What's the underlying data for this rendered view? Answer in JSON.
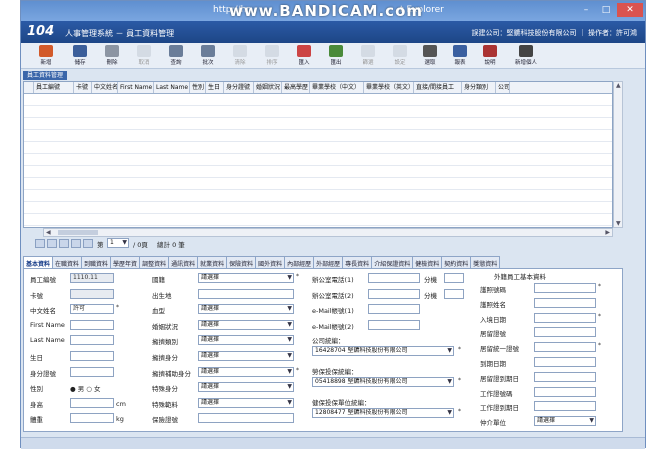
{
  "window": {
    "title_url": "http://hr",
    "title_app": "t Explorer",
    "watermark": "www.BANDICAM.com"
  },
  "app": {
    "logo": "104",
    "title": "人事管理系統 － 員工資料管理",
    "company": "誤建公司：堅鑣科技股份有限公司 ｜ 操作者：許可鴻"
  },
  "toolbar": [
    {
      "label": "新增",
      "icon": "new-icon",
      "color": "#d25a2a",
      "enabled": true
    },
    {
      "label": "儲存",
      "icon": "save-icon",
      "color": "#3b5e9a",
      "enabled": true
    },
    {
      "label": "刪除",
      "icon": "delete-icon",
      "color": "#8c95a3",
      "enabled": true
    },
    {
      "label": "取消",
      "icon": "cancel-icon",
      "color": "#b0b8c4",
      "enabled": false
    },
    {
      "label": "查詢",
      "icon": "query-icon",
      "color": "#6a7d99",
      "enabled": true
    },
    {
      "label": "批次",
      "icon": "batch-icon",
      "color": "#6a7d99",
      "enabled": true
    },
    {
      "label": "清除",
      "icon": "clear-icon",
      "color": "#b0b8c4",
      "enabled": false
    },
    {
      "label": "排序",
      "icon": "sort-icon",
      "color": "#b0b8c4",
      "enabled": false
    },
    {
      "label": "匯入",
      "icon": "import-icon",
      "color": "#c44",
      "enabled": true
    },
    {
      "label": "匯出",
      "icon": "export-icon",
      "color": "#4a8a3a",
      "enabled": true
    },
    {
      "label": "篩選",
      "icon": "filter-icon",
      "color": "#b0b8c4",
      "enabled": false
    },
    {
      "label": "設定",
      "icon": "settings-icon",
      "color": "#b0b8c4",
      "enabled": false
    },
    {
      "label": "選取",
      "icon": "select-icon",
      "color": "#555",
      "enabled": true
    },
    {
      "label": "報表",
      "icon": "report-icon",
      "color": "#3a5fa0",
      "enabled": true
    },
    {
      "label": "說明",
      "icon": "help-icon",
      "color": "#aa3333",
      "enabled": true
    },
    {
      "label": "新增個人",
      "icon": "add-person-icon",
      "color": "#444",
      "enabled": true
    }
  ],
  "grid": {
    "group_title": "員工資料管理",
    "columns": [
      "員工編號",
      "卡號",
      "中文姓名",
      "First Name",
      "Last Name",
      "性別",
      "生日",
      "身分證號",
      "婚姻狀況",
      "最高學歷",
      "畢業學校（中文）",
      "畢業學校（英文）",
      "直接/間接員工",
      "身分類別",
      "公司"
    ]
  },
  "pager": {
    "page_label": "第",
    "page_value": "1",
    "total_label": "/ 0頁",
    "count_label": "總計 0 筆"
  },
  "tabs": [
    "基本資料",
    "在職資料",
    "到職資料",
    "學歷年資",
    "調整資料",
    "通訊資料",
    "就業資料",
    "保險資料",
    "國外資料",
    "內部經歷",
    "外部經歷",
    "專長資料",
    "介紹保證資料",
    "健檢資料",
    "契約資料",
    "獎懲資料"
  ],
  "form": {
    "col1": [
      {
        "label": "員工編號",
        "value": "1110.11",
        "type": "ro"
      },
      {
        "label": "卡號",
        "value": "",
        "type": "ro"
      },
      {
        "label": "中文姓名",
        "value": "許可",
        "type": "text",
        "star": "*"
      },
      {
        "label": "First Name",
        "value": "",
        "type": "text"
      },
      {
        "label": "Last Name",
        "value": "",
        "type": "text"
      },
      {
        "label": "生日",
        "value": "",
        "type": "text"
      },
      {
        "label": "身分證號",
        "value": "",
        "type": "text"
      },
      {
        "label": "性別",
        "value": "",
        "type": "radio"
      },
      {
        "label": "身高",
        "value": "",
        "type": "text",
        "unit": "cm"
      },
      {
        "label": "體重",
        "value": "",
        "type": "text",
        "unit": "kg"
      }
    ],
    "gender": {
      "male": "男",
      "female": "女"
    },
    "col2": [
      {
        "label": "國籍",
        "value": "請選擇",
        "type": "select",
        "star": "*"
      },
      {
        "label": "出生地",
        "value": "",
        "type": "text"
      },
      {
        "label": "血型",
        "value": "請選擇",
        "type": "select"
      },
      {
        "label": "婚姻狀況",
        "value": "請選擇",
        "type": "select"
      },
      {
        "label": "擁擠類別",
        "value": "請選擇",
        "type": "select"
      },
      {
        "label": "擁擠身分",
        "value": "請選擇",
        "type": "select"
      },
      {
        "label": "擁擠補助身分",
        "value": "請選擇",
        "type": "select",
        "star": "*"
      },
      {
        "label": "特殊身分",
        "value": "請選擇",
        "type": "select"
      },
      {
        "label": "特殊範料",
        "value": "請選擇",
        "type": "select"
      },
      {
        "label": "保險證號",
        "value": "",
        "type": "text"
      }
    ],
    "col3": [
      {
        "label": "辦公室電話(1)",
        "value": "",
        "type": "text",
        "ext": "分機"
      },
      {
        "label": "辦公室電話(2)",
        "value": "",
        "type": "text",
        "ext": "分機"
      },
      {
        "label": "e-Mail帳號(1)",
        "value": "",
        "type": "text"
      },
      {
        "label": "e-Mail帳號(2)",
        "value": "",
        "type": "text"
      }
    ],
    "company_label": "公司統編：",
    "company_value": "16428704 堅鑣科技股份有限公司",
    "dept_label": "勞保投保統編：",
    "dept_value": "05418898 堅鑣科技股份有限公司",
    "health_label": "健保投保單位統編：",
    "health_value": "12808477 堅鑣科技股份有限公司",
    "foreign_title": "外籍員工基本資料",
    "col4": [
      {
        "label": "護照號碼",
        "value": "",
        "type": "text",
        "star": "*"
      },
      {
        "label": "護照姓名",
        "value": "",
        "type": "text"
      },
      {
        "label": "入境日期",
        "value": "",
        "type": "text",
        "star": "*"
      },
      {
        "label": "居留證號",
        "value": "",
        "type": "text"
      },
      {
        "label": "居留統一證號",
        "value": "",
        "type": "text",
        "star": "*"
      },
      {
        "label": "到期日期",
        "value": "",
        "type": "text"
      },
      {
        "label": "居留證到期日",
        "value": "",
        "type": "text"
      },
      {
        "label": "工作證號碼",
        "value": "",
        "type": "text"
      },
      {
        "label": "工作證到期日",
        "value": "",
        "type": "text"
      },
      {
        "label": "仲介單位",
        "value": "請選擇",
        "type": "select"
      }
    ]
  },
  "select_default": "請選擇"
}
